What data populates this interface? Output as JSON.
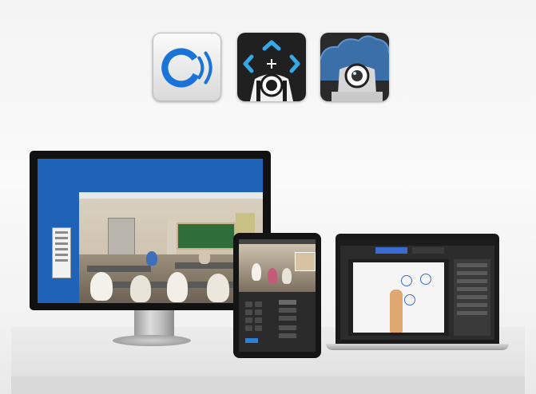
{
  "icons": [
    {
      "name": "live-stream-app-icon"
    },
    {
      "name": "ptz-camera-control-app-icon"
    },
    {
      "name": "cloud-camera-app-icon"
    }
  ],
  "colors": {
    "app_blue": "#1a73d9",
    "screen_blue": "#1f63b8",
    "accent_light_blue": "#35a8e8"
  }
}
